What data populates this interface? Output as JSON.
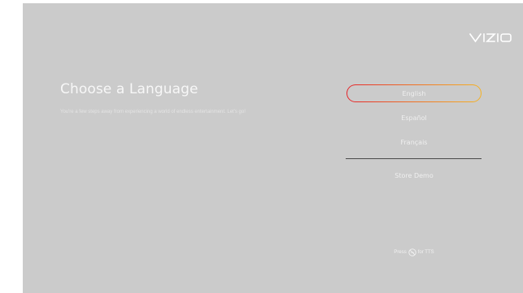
{
  "brand": {
    "logo_text": "VIZIO",
    "logo_color": "#ffffff"
  },
  "heading": {
    "title": "Choose a Language",
    "subtitle": "You're a few steps away from experiencing a world of endless entertainment. Let's go!"
  },
  "languages": {
    "options": [
      {
        "label": "English",
        "focused": true
      },
      {
        "label": "Español",
        "focused": false
      },
      {
        "label": "Français",
        "focused": false
      }
    ],
    "store_demo_label": "Store Demo"
  },
  "tts_hint": {
    "prefix": "Press",
    "icon": "tts-remote-button-icon",
    "suffix": "for TTS"
  },
  "colors": {
    "background": "#cbcbcb",
    "focus_ring_start": "#e5232a",
    "focus_ring_end": "#f6b323",
    "text": "#f0f0f0"
  }
}
